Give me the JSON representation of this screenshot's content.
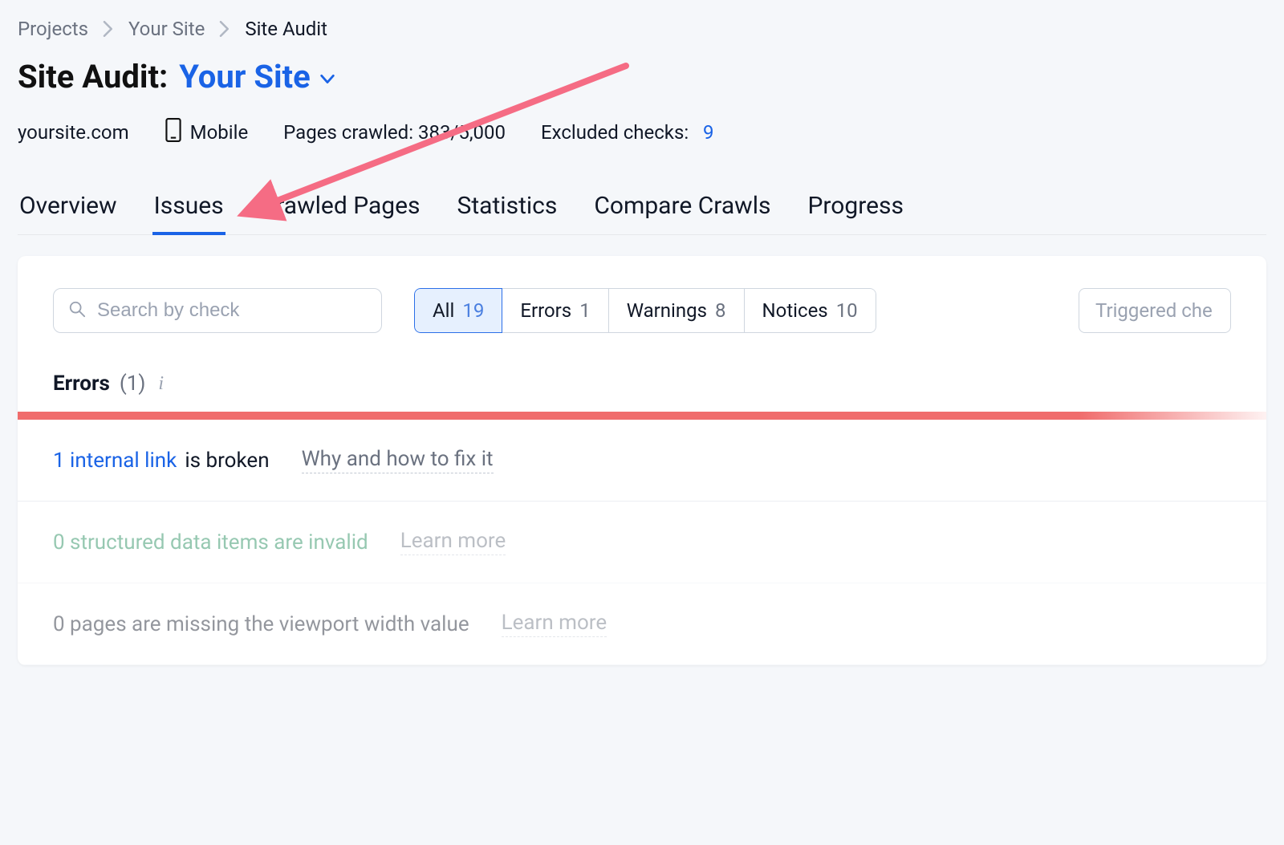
{
  "breadcrumb": {
    "items": [
      {
        "label": "Projects"
      },
      {
        "label": "Your Site"
      },
      {
        "label": "Site Audit"
      }
    ]
  },
  "header": {
    "title_prefix": "Site Audit:",
    "site_name": "Your Site"
  },
  "info": {
    "domain": "yoursite.com",
    "device": "Mobile",
    "crawled_label": "Pages crawled: 383/5,000",
    "excluded_label": "Excluded checks:",
    "excluded_count": "9"
  },
  "tabs": [
    {
      "label": "Overview"
    },
    {
      "label": "Issues"
    },
    {
      "label": "Crawled Pages"
    },
    {
      "label": "Statistics"
    },
    {
      "label": "Compare Crawls"
    },
    {
      "label": "Progress"
    }
  ],
  "search": {
    "placeholder": "Search by check"
  },
  "filters": [
    {
      "label": "All",
      "count": "19"
    },
    {
      "label": "Errors",
      "count": "1"
    },
    {
      "label": "Warnings",
      "count": "8"
    },
    {
      "label": "Notices",
      "count": "10"
    }
  ],
  "ghost_dropdown": "Triggered che",
  "errors_section": {
    "label": "Errors",
    "count": "(1)"
  },
  "issues": [
    {
      "link_text": "1 internal link",
      "rest_text": " is broken",
      "help_text": "Why and how to fix it",
      "link_class": "link",
      "dim": false
    },
    {
      "link_text": "0 structured data items are invalid",
      "rest_text": "",
      "help_text": "Learn more",
      "link_class": "link-green",
      "dim": true
    },
    {
      "link_text": "0 pages are missing the viewport width value",
      "rest_text": "",
      "help_text": "Learn more",
      "link_class": "rest",
      "dim": true
    }
  ],
  "annotation": {
    "color": "#f56c84"
  }
}
